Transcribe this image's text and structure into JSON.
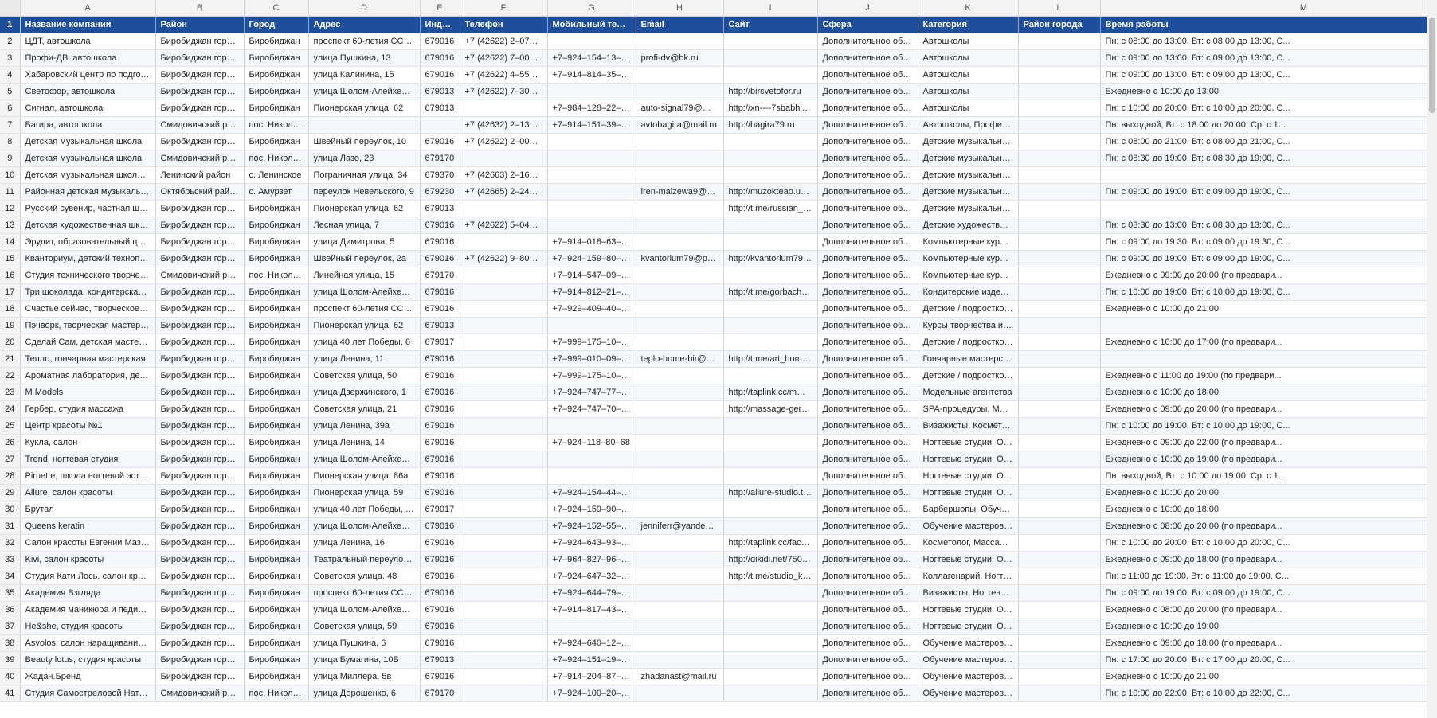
{
  "columns": [
    "A",
    "B",
    "C",
    "D",
    "E",
    "F",
    "G",
    "H",
    "I",
    "J",
    "K",
    "L",
    "M"
  ],
  "headers": [
    "Название компании",
    "Район",
    "Город",
    "Адрес",
    "Индекс",
    "Телефон",
    "Мобильный телефон",
    "Email",
    "Сайт",
    "Сфера",
    "Категория",
    "Район города",
    "Время работы"
  ],
  "header_row_number": "1",
  "rows": [
    {
      "n": "2",
      "c": [
        "ЦДТ, автошкола",
        "Биробиджан городско...",
        "Биробиджан",
        "проспект 60-летия СССР, 12",
        "679016",
        "+7 (42622) 2–07–23",
        "",
        "",
        "",
        "Дополнительное образов...",
        "Автошколы",
        "",
        "Пн: с 08:00 до 13:00, Вт: с 08:00 до 13:00, С..."
      ]
    },
    {
      "n": "3",
      "c": [
        "Профи-ДВ, автошкола",
        "Биробиджан городско...",
        "Биробиджан",
        "улица Пушкина, 13",
        "679016",
        "+7 (42622) 7–00–13",
        "+7–924–154–13–13",
        "profi-dv@bk.ru",
        "",
        "Дополнительное образов...",
        "Автошколы",
        "",
        "Пн: с 09:00 до 13:00, Вт: с 09:00 до 13:00, С..."
      ]
    },
    {
      "n": "4",
      "c": [
        "Хабаровский центр по подготовке и ...",
        "Биробиджан городско...",
        "Биробиджан",
        "улица Калинина, 15",
        "679016",
        "+7 (42622) 4–55–76",
        "+7–914–814–35–34",
        "",
        "",
        "Дополнительное образов...",
        "Автошколы",
        "",
        "Пн: с 09:00 до 13:00, Вт: с 09:00 до 13:00, С..."
      ]
    },
    {
      "n": "5",
      "c": [
        "Светофор, автошкола",
        "Биробиджан городско...",
        "Биробиджан",
        "улица Шолом-Алейхема, 96",
        "679013",
        "+7 (42622) 7–30–03",
        "",
        "",
        "http://birsvetofor.ru",
        "Дополнительное образов...",
        "Автошколы",
        "",
        "Ежедневно с 10:00 до 13:00"
      ]
    },
    {
      "n": "6",
      "c": [
        "Сигнал, автошкола",
        "Биробиджан городско...",
        "Биробиджан",
        "Пионерская улица, 62",
        "679013",
        "",
        "+7–984–128–22–50",
        "auto-signal79@mail.ru",
        "http://xn----7sbabhi8anjf...",
        "Дополнительное образов...",
        "Автошколы",
        "",
        "Пн: с 10:00 до 20:00, Вт: с 10:00 до 20:00, С..."
      ]
    },
    {
      "n": "7",
      "c": [
        "Багира, автошкола",
        "Смидовичский район",
        "пос. Николаевка",
        "",
        "",
        "+7 (42632) 2–13–82",
        "+7–914–151–39–94",
        "avtobagira@mail.ru",
        "http://bagira79.ru",
        "Дополнительное образов...",
        "Автошколы, Профессиона...",
        "",
        "Пн: выходной, Вт: с 18:00 до 20:00, Ср: с 1..."
      ]
    },
    {
      "n": "8",
      "c": [
        "Детская музыкальная школа",
        "Биробиджан городско...",
        "Биробиджан",
        "Швейный переулок, 10",
        "679016",
        "+7 (42622) 2–00–28, +7...",
        "",
        "",
        "",
        "Дополнительное образов...",
        "Детские музыкальные школ...",
        "",
        "Пн: с 08:00 до 21:00, Вт: с 08:00 до 21:00, С..."
      ]
    },
    {
      "n": "9",
      "c": [
        "Детская музыкальная школа",
        "Смидовичский район",
        "пос. Николаевка",
        "улица Лазо, 23",
        "679170",
        "",
        "",
        "",
        "",
        "Дополнительное образов...",
        "Детские музыкальные школ...",
        "",
        "Пн: с 08:30 до 19:00, Вт: с 08:30 до 19:00, С..."
      ]
    },
    {
      "n": "10",
      "c": [
        "Детская музыкальная школа Ленинск...",
        "Ленинский район",
        "с. Ленинское",
        "Пограничная улица, 34",
        "679370",
        "+7 (42663) 2–16–76",
        "",
        "",
        "",
        "Дополнительное образов...",
        "Детские музыкальные школ...",
        "",
        ""
      ]
    },
    {
      "n": "11",
      "c": [
        "Районная детская музыкальная школа",
        "Октябрьский район",
        "с. Амурзет",
        "переулок Невельского, 9",
        "679230",
        "+7 (42665) 2–24–04",
        "",
        "iren-malzewa9@mail.ru,...",
        "http://muzokteao.ucoz.ru",
        "Дополнительное образов...",
        "Детские музыкальные школ...",
        "",
        "Пн: с 09:00 до 19:00, Вт: с 09:00 до 19:00, С..."
      ]
    },
    {
      "n": "12",
      "c": [
        "Русский сувенир, частная школа хоро...",
        "Биробиджан городско...",
        "Биробиджан",
        "Пионерская улица, 62",
        "679013",
        "",
        "",
        "",
        "http://t.me/russian_souve...",
        "Дополнительное образов...",
        "Детские музыкальные школ...",
        "",
        ""
      ]
    },
    {
      "n": "13",
      "c": [
        "Детская художественная школа",
        "Биробиджан городско...",
        "Биробиджан",
        "Лесная улица, 7",
        "679016",
        "+7 (42622) 5–04–18",
        "",
        "",
        "",
        "Дополнительное образов...",
        "Детские художественные ...",
        "",
        "Пн: с 08:30 до 13:00, Вт: с 08:30 до 13:00, С..."
      ]
    },
    {
      "n": "14",
      "c": [
        "Эрудит, образовательный центр",
        "Биробиджан городско...",
        "Биробиджан",
        "улица Димитрова, 5",
        "679016",
        "",
        "+7–914–018–63–80",
        "",
        "",
        "Дополнительное образов...",
        "Компьютерные курсы, Не...",
        "",
        "Пн: с 09:00 до 19:30, Вт: с 09:00 до 19:30, С..."
      ]
    },
    {
      "n": "15",
      "c": [
        "Кванториум, детский технопарк",
        "Биробиджан городско...",
        "Биробиджан",
        "Швейный переулок, 2а",
        "679016",
        "+7 (42622) 9–80–90",
        "+7–924–159–80–90",
        "kvantorium79@post.eao",
        "http://kvantorium79.ru",
        "Дополнительное образов...",
        "Компьютерные курсы, Кур...",
        "",
        "Пн: с 09:00 до 19:00, Вт: с 09:00 до 19:00, С..."
      ]
    },
    {
      "n": "16",
      "c": [
        "Студия технического творчества",
        "Смидовичский район",
        "пос. Николаевка",
        "Линейная улица, 15",
        "679170",
        "",
        "+7–914–547–09–01",
        "",
        "",
        "Дополнительное образов...",
        "Компьютерные курсы, По...",
        "",
        "Ежедневно с 09:00 до 20:00 (по предвари..."
      ]
    },
    {
      "n": "17",
      "c": [
        "Три шоколада, кондитерская мастерс...",
        "Биробиджан городско...",
        "Биробиджан",
        "улица Шолом-Алейхема, 8",
        "679016",
        "",
        "+7–914–812–21–67",
        "",
        "http://t.me/gorbacheva79",
        "Дополнительное образов...",
        "Кондитерские изделия, Ку...",
        "",
        "Пн: с 10:00 до 19:00, Вт: с 10:00 до 19:00, С..."
      ]
    },
    {
      "n": "18",
      "c": [
        "Счастье сейчас, творческое простран...",
        "Биробиджан городско...",
        "Биробиджан",
        "проспект 60-летия СССР, 11",
        "679016",
        "",
        "+7–929–409–40–17",
        "",
        "",
        "Дополнительное образов...",
        "Детские / подростковые к...",
        "",
        "Ежедневно с 10:00 до 21:00"
      ]
    },
    {
      "n": "19",
      "c": [
        "Пэчворк, творческая мастерская",
        "Биробиджан городско...",
        "Биробиджан",
        "Пионерская улица, 62",
        "679013",
        "",
        "",
        "",
        "",
        "Дополнительное образов...",
        "Курсы творчества и рукод...",
        "",
        ""
      ]
    },
    {
      "n": "20",
      "c": [
        "Сделай Сам, детская мастерская",
        "Биробиджан городско...",
        "Биробиджан",
        "улица 40 лет Победы, 6",
        "679017",
        "",
        "+7–999–175–10–73",
        "",
        "",
        "Дополнительное образов...",
        "Детские / подростковые к...",
        "",
        "Ежедневно с 10:00 до 17:00 (по предвари..."
      ]
    },
    {
      "n": "21",
      "c": [
        "Тепло, гончарная мастерская",
        "Биробиджан городско...",
        "Биробиджан",
        "улица Ленина, 11",
        "679016",
        "",
        "+7–999–010–09–20",
        "teplo-home-bir@yande...",
        "http://t.me/art_home_tepl...",
        "Дополнительное образов...",
        "Гончарные мастерские, Ку...",
        "",
        ""
      ]
    },
    {
      "n": "22",
      "c": [
        "Ароматная лаборатория, детская мас...",
        "Биробиджан городско...",
        "Биробиджан",
        "Советская улица, 50",
        "679016",
        "",
        "+7–999–175–10–73",
        "",
        "",
        "Дополнительное образов...",
        "Детские / подростковые к...",
        "",
        "Ежедневно с 11:00 до 19:00 (по предвари..."
      ]
    },
    {
      "n": "23",
      "c": [
        "M Models",
        "Биробиджан городско...",
        "Биробиджан",
        "улица Дзержинского, 1",
        "679016",
        "",
        "+7–924–747–77–87",
        "",
        "http://taplink.cc/mmodels",
        "Дополнительное образов...",
        "Модельные агентства",
        "",
        "Ежедневно с 10:00 до 18:00"
      ]
    },
    {
      "n": "24",
      "c": [
        "Гербер, студия массажа",
        "Биробиджан городско...",
        "Биробиджан",
        "Советская улица, 21",
        "679016",
        "",
        "+7–924–747–70–71",
        "",
        "http://massage-gerber.ru",
        "Дополнительное образов...",
        "SPA-процедуры, Массажи...",
        "",
        "Ежедневно с 09:00 до 20:00 (по предвари..."
      ]
    },
    {
      "n": "25",
      "c": [
        "Центр красоты №1",
        "Биробиджан городско...",
        "Биробиджан",
        "улица Ленина, 39а",
        "679016",
        "",
        "",
        "",
        "",
        "Дополнительное образов...",
        "Визажисты, Косметолог, М...",
        "",
        "Пн: с 10:00 до 19:00, Вт: с 10:00 до 19:00, С..."
      ]
    },
    {
      "n": "26",
      "c": [
        "Кукла, салон",
        "Биробиджан городско...",
        "Биробиджан",
        "улица Ленина, 14",
        "679016",
        "",
        "+7–924–118–80–68",
        "",
        "",
        "Дополнительное образов...",
        "Ногтевые студии, Обучени...",
        "",
        "Ежедневно с 09:00 до 22:00 (по предвари..."
      ]
    },
    {
      "n": "27",
      "c": [
        "Trend, ногтевая студия",
        "Биробиджан городско...",
        "Биробиджан",
        "улица Шолом-Алейхема, 15а",
        "679016",
        "",
        "",
        "",
        "",
        "Дополнительное образов...",
        "Ногтевые студии, Обучени...",
        "",
        "Ежедневно с 10:00 до 19:00 (по предвари..."
      ]
    },
    {
      "n": "28",
      "c": [
        "Piruette, школа ногтевой эстетики",
        "Биробиджан городско...",
        "Биробиджан",
        "Пионерская улица, 86а",
        "679016",
        "",
        "",
        "",
        "",
        "Дополнительное образов...",
        "Ногтевые студии, Обучени...",
        "",
        "Пн: выходной, Вт: с 10:00 до 19:00, Ср: с 1..."
      ]
    },
    {
      "n": "29",
      "c": [
        "Allure, салон красоты",
        "Биробиджан городско...",
        "Биробиджан",
        "Пионерская улица, 59",
        "679016",
        "",
        "+7–924–154–44–08",
        "",
        "http://allure-studio.tilda.w...",
        "Дополнительное образов...",
        "Ногтевые студии, Обучени...",
        "",
        "Ежедневно с 10:00 до 20:00"
      ]
    },
    {
      "n": "30",
      "c": [
        "Брутал",
        "Биробиджан городско...",
        "Биробиджан",
        "улица 40 лет Победы, 10",
        "679017",
        "",
        "+7–924–159–90–99",
        "",
        "",
        "Дополнительное образов...",
        "Барбершопы, Обучение м...",
        "",
        "Ежедневно с 10:00 до 18:00"
      ]
    },
    {
      "n": "31",
      "c": [
        "Queens keratin",
        "Биробиджан городско...",
        "Биробиджан",
        "улица Шолом-Алейхема, 44",
        "679016",
        "",
        "+7–924–152–55–54, +7...",
        "jenniferr@yandex.ru",
        "",
        "Дополнительное образов...",
        "Обучение мастеров для са...",
        "",
        "Ежедневно с 08:00 до 20:00 (по предвари..."
      ]
    },
    {
      "n": "32",
      "c": [
        "Салон красоты Евгении Мазуровой",
        "Биробиджан городско...",
        "Биробиджан",
        "улица Ленина, 16",
        "679016",
        "",
        "+7–924–643–93–76, +7...",
        "",
        "http://taplink.cc/faceexpert",
        "Дополнительное образов...",
        "Косметолог, Массажист, О...",
        "",
        "Пн: с 10:00 до 20:00, Вт: с 10:00 до 20:00, С..."
      ]
    },
    {
      "n": "33",
      "c": [
        "Kivi, салон красоты",
        "Биробиджан городско...",
        "Биробиджан",
        "Театральный переулок, 4",
        "679016",
        "",
        "+7–964–827–96–17",
        "",
        "http://dikidi.net/750839",
        "Дополнительное образов...",
        "Ногтевые студии, Обучени...",
        "",
        "Ежедневно с 09:00 до 18:00 (по предвари..."
      ]
    },
    {
      "n": "34",
      "c": [
        "Студия Кати Лось, салон красоты",
        "Биробиджан городско...",
        "Биробиджан",
        "Советская улица, 48",
        "679016",
        "",
        "+7–924–647–32–55",
        "",
        "http://t.me/studio_katylos",
        "Дополнительное образов...",
        "Коллагенарий, Ногтевые с...",
        "",
        "Пн: с 11:00 до 19:00, Вт: с 11:00 до 19:00, С..."
      ]
    },
    {
      "n": "35",
      "c": [
        "Академия Взгляда",
        "Биробиджан городско...",
        "Биробиджан",
        "проспект 60-летия СССР, 1",
        "679016",
        "",
        "+7–924–644–79–79, +7...",
        "",
        "",
        "Дополнительное образов...",
        "Визажисты, Ногтевые студ...",
        "",
        "Пн: с 09:00 до 19:00, Вт: с 09:00 до 19:00, С..."
      ]
    },
    {
      "n": "36",
      "c": [
        "Академия маникюра и педикюра",
        "Биробиджан городско...",
        "Биробиджан",
        "улица Шолом-Алейхема, 20",
        "679016",
        "",
        "+7–914–817–43–21",
        "",
        "",
        "Дополнительное образов...",
        "Ногтевые студии, Обучени...",
        "",
        "Ежедневно с 08:00 до 20:00 (по предвари..."
      ]
    },
    {
      "n": "37",
      "c": [
        "He&she, студия красоты",
        "Биробиджан городско...",
        "Биробиджан",
        "Советская улица, 59",
        "679016",
        "",
        "",
        "",
        "",
        "Дополнительное образов...",
        "Ногтевые студии, Обучени...",
        "",
        "Ежедневно с 10:00 до 19:00"
      ]
    },
    {
      "n": "38",
      "c": [
        "Asvolos, салон наращивания волос",
        "Биробиджан городско...",
        "Биробиджан",
        "улица Пушкина, 6",
        "679016",
        "",
        "+7–924–640–12–16, +7...",
        "",
        "",
        "Дополнительное образов...",
        "Обучение мастеров для са...",
        "",
        "Ежедневно с 09:00 до 18:00 (по предвари..."
      ]
    },
    {
      "n": "39",
      "c": [
        "Beauty lotus, студия красоты",
        "Биробиджан городско...",
        "Биробиджан",
        "улица Бумагина, 10Б",
        "679013",
        "",
        "+7–924–151–19–89",
        "",
        "",
        "Дополнительное образов...",
        "Обучение мастеров для са...",
        "",
        "Пн: с 17:00 до 20:00, Вт: с 17:00 до 20:00, С..."
      ]
    },
    {
      "n": "40",
      "c": [
        "Жадан.Бренд",
        "Биробиджан городско...",
        "Биробиджан",
        "улица Миллера, 5в",
        "679016",
        "",
        "+7–914–204–87–87",
        "zhadanast@mail.ru",
        "",
        "Дополнительное образов...",
        "Обучение мастеров для са...",
        "",
        "Ежедневно с 10:00 до 21:00"
      ]
    },
    {
      "n": "41",
      "c": [
        "Студия Самострeловой Натальи",
        "Смидовичский район",
        "пос. Николаевка",
        "улица Дорошенко, 6",
        "679170",
        "",
        "+7–924–100–20–86",
        "",
        "",
        "Дополнительное образов...",
        "Обучение мастеров для са...",
        "",
        "Пн: с 10:00 до 22:00, Вт: с 10:00 до 22:00, С..."
      ]
    }
  ]
}
